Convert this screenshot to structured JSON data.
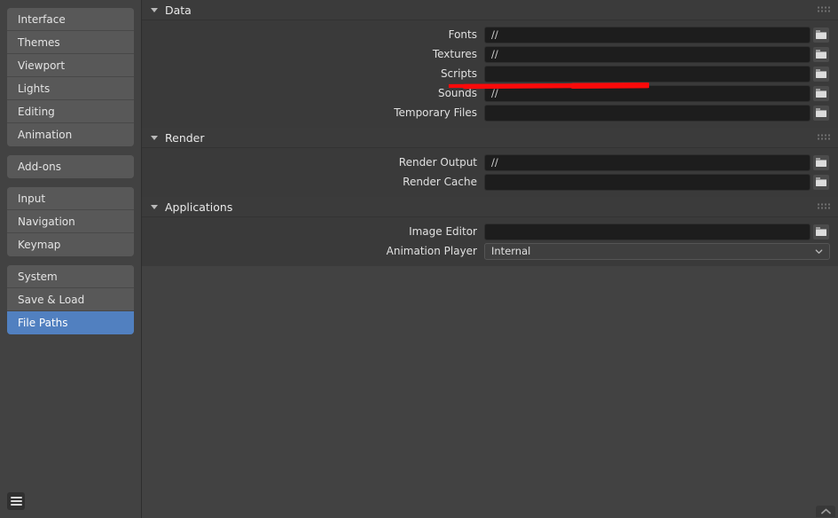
{
  "sidebar": {
    "groups": [
      {
        "items": [
          {
            "label": "Interface",
            "selected": false
          },
          {
            "label": "Themes",
            "selected": false
          },
          {
            "label": "Viewport",
            "selected": false
          },
          {
            "label": "Lights",
            "selected": false
          },
          {
            "label": "Editing",
            "selected": false
          },
          {
            "label": "Animation",
            "selected": false
          }
        ]
      },
      {
        "items": [
          {
            "label": "Add-ons",
            "selected": false
          }
        ]
      },
      {
        "items": [
          {
            "label": "Input",
            "selected": false
          },
          {
            "label": "Navigation",
            "selected": false
          },
          {
            "label": "Keymap",
            "selected": false
          }
        ]
      },
      {
        "items": [
          {
            "label": "System",
            "selected": false
          },
          {
            "label": "Save & Load",
            "selected": false
          },
          {
            "label": "File Paths",
            "selected": true
          }
        ]
      }
    ],
    "menu_icon": "hamburger-menu-icon"
  },
  "panels": [
    {
      "title": "Data",
      "expanded": true,
      "rows": [
        {
          "label": "Fonts",
          "value": "//",
          "placeholder": "",
          "widget": "path"
        },
        {
          "label": "Textures",
          "value": "//",
          "placeholder": "",
          "widget": "path"
        },
        {
          "label": "Scripts",
          "value": "",
          "placeholder": "",
          "widget": "path"
        },
        {
          "label": "Sounds",
          "value": "//",
          "placeholder": "",
          "widget": "path"
        },
        {
          "label": "Temporary Files",
          "value": "",
          "placeholder": "",
          "widget": "path"
        }
      ]
    },
    {
      "title": "Render",
      "expanded": true,
      "rows": [
        {
          "label": "Render Output",
          "value": "//",
          "placeholder": "",
          "widget": "path"
        },
        {
          "label": "Render Cache",
          "value": "",
          "placeholder": "",
          "widget": "path"
        }
      ]
    },
    {
      "title": "Applications",
      "expanded": true,
      "rows": [
        {
          "label": "Image Editor",
          "value": "",
          "placeholder": "",
          "widget": "path"
        },
        {
          "label": "Animation Player",
          "value": "Internal",
          "placeholder": "",
          "widget": "dropdown"
        }
      ]
    }
  ],
  "annotation": {
    "type": "freehand-strike",
    "color": "#fa0a0a",
    "target_row_label": "Scripts"
  },
  "colors": {
    "accent_selected": "#5180c0",
    "window_bg": "#424242",
    "panel_header_bg": "#3b3b3b",
    "panel_body_bg": "#3a3a3a",
    "field_bg": "#1d1d1d",
    "nav_item_bg": "#585858",
    "annotation_red": "#fa0a0a"
  },
  "icons": {
    "folder": "folder-icon",
    "chevron_down": "chevron-down-icon",
    "chevron_up": "chevron-up-icon",
    "grip": "grip-dots-icon",
    "disclosure": "disclosure-triangle-icon"
  }
}
